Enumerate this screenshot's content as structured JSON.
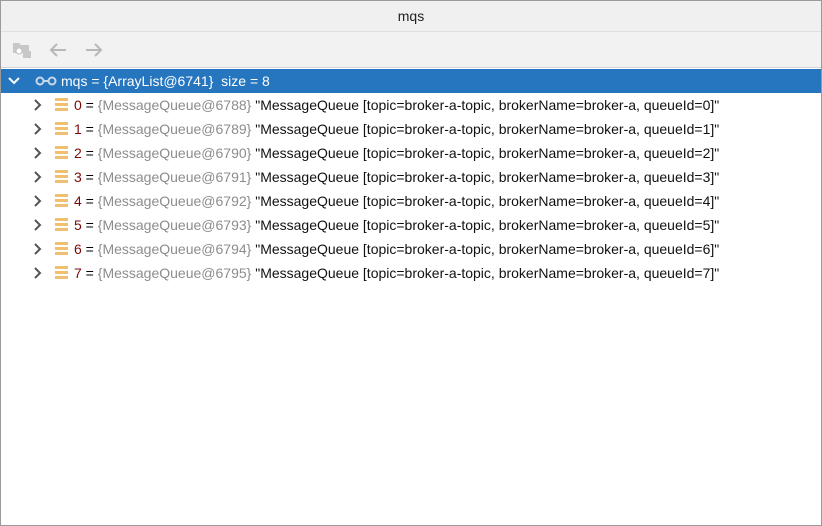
{
  "window": {
    "title": "mqs"
  },
  "toolbar": {
    "icons": [
      "frame-icon",
      "back-arrow-icon",
      "forward-arrow-icon"
    ]
  },
  "colors": {
    "selection": "#2675bf",
    "index": "#7a0a0a",
    "type": "#8c8c8c",
    "field_icon": "#f0c070"
  },
  "root": {
    "name": "mqs",
    "type": "{ArrayList@6741}",
    "extra": "size = 8"
  },
  "items": [
    {
      "index": "0",
      "type": "{MessageQueue@6788}",
      "value": "\"MessageQueue [topic=broker-a-topic, brokerName=broker-a, queueId=0]\""
    },
    {
      "index": "1",
      "type": "{MessageQueue@6789}",
      "value": "\"MessageQueue [topic=broker-a-topic, brokerName=broker-a, queueId=1]\""
    },
    {
      "index": "2",
      "type": "{MessageQueue@6790}",
      "value": "\"MessageQueue [topic=broker-a-topic, brokerName=broker-a, queueId=2]\""
    },
    {
      "index": "3",
      "type": "{MessageQueue@6791}",
      "value": "\"MessageQueue [topic=broker-a-topic, brokerName=broker-a, queueId=3]\""
    },
    {
      "index": "4",
      "type": "{MessageQueue@6792}",
      "value": "\"MessageQueue [topic=broker-a-topic, brokerName=broker-a, queueId=4]\""
    },
    {
      "index": "5",
      "type": "{MessageQueue@6793}",
      "value": "\"MessageQueue [topic=broker-a-topic, brokerName=broker-a, queueId=5]\""
    },
    {
      "index": "6",
      "type": "{MessageQueue@6794}",
      "value": "\"MessageQueue [topic=broker-a-topic, brokerName=broker-a, queueId=6]\""
    },
    {
      "index": "7",
      "type": "{MessageQueue@6795}",
      "value": "\"MessageQueue [topic=broker-a-topic, brokerName=broker-a, queueId=7]\""
    }
  ]
}
